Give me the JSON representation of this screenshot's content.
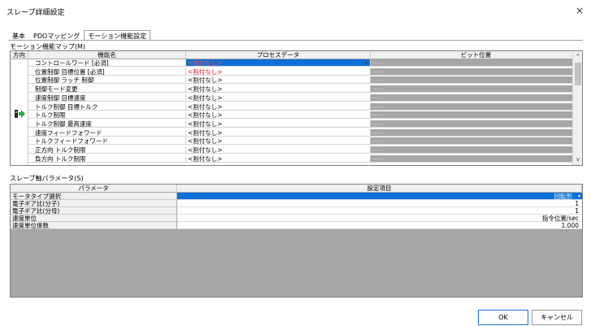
{
  "window": {
    "title": "スレーブ詳細設定",
    "close_glyph": "×"
  },
  "tabs": [
    {
      "label": "基本",
      "active": false
    },
    {
      "label": "PDOマッピング",
      "active": false
    },
    {
      "label": "モーション機能設定",
      "active": true
    }
  ],
  "motion_map": {
    "section_label": "モーション機能マップ(M)",
    "columns": {
      "direction": "方向",
      "function_name": "機能名",
      "process_data": "プロセスデータ",
      "bit_position": "ビット位置"
    },
    "rows": [
      {
        "name": "コントロールワード [必須]",
        "process": "<割付なし>",
        "bit": "-----"
      },
      {
        "name": "位置制御 目標位置 [必須]",
        "process": "<割付なし>",
        "bit": "-----"
      },
      {
        "name": "位置制御 ラッチ 制御",
        "process": "<割付なし>",
        "bit": "-----"
      },
      {
        "name": "制御モード変更",
        "process": "<割付なし>",
        "bit": "-----"
      },
      {
        "name": "速度制御 目標速度",
        "process": "<割付なし>",
        "bit": "-----"
      },
      {
        "name": "トルク制御 目標トルク",
        "process": "<割付なし>",
        "bit": "-----"
      },
      {
        "name": "トルク制限",
        "process": "<割付なし>",
        "bit": "-----"
      },
      {
        "name": "トルク制御 最高速度",
        "process": "<割付なし>",
        "bit": "-----"
      },
      {
        "name": "速度フィードフォワード",
        "process": "<割付なし>",
        "bit": "-----"
      },
      {
        "name": "トルクフィードフォワード",
        "process": "<割付なし>",
        "bit": "-----"
      },
      {
        "name": "正方向 トルク制限",
        "process": "<割付なし>",
        "bit": "-----"
      },
      {
        "name": "負方向 トルク制限",
        "process": "<割付なし>",
        "bit": "-----"
      }
    ],
    "scroll_up": "^",
    "scroll_down": "v",
    "dropdown_arrow": "▾"
  },
  "slave_params": {
    "section_label": "スレーブ軸パラメータ(S)",
    "columns": {
      "parameter": "パラメータ",
      "setting": "設定項目"
    },
    "rows": [
      {
        "name": "モータタイプ選択",
        "value": "回転形"
      },
      {
        "name": "電子ギア比(分子)",
        "value": "1"
      },
      {
        "name": "電子ギア比(分母)",
        "value": "1"
      },
      {
        "name": "速度単位",
        "value": "指令位置/sec"
      },
      {
        "name": "速度単位係数",
        "value": "1.000"
      }
    ]
  },
  "buttons": {
    "ok": "OK",
    "cancel": "キャンセル"
  },
  "colors": {
    "selection": "#0b6fd8",
    "unassigned_red": "#e0191c",
    "bit_column_gray": "#a6a6a6"
  }
}
